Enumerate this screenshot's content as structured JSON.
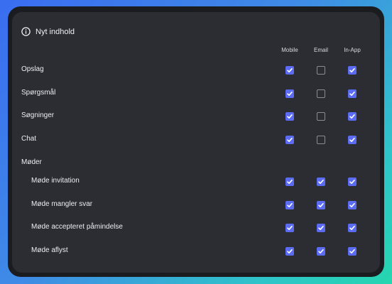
{
  "section": {
    "title": "Nyt indhold"
  },
  "columns": [
    "Mobile",
    "Email",
    "In-App"
  ],
  "rows": [
    {
      "label": "Opslag",
      "mobile": true,
      "email": false,
      "inapp": true
    },
    {
      "label": "Spørgsmål",
      "mobile": true,
      "email": false,
      "inapp": true
    },
    {
      "label": "Søgninger",
      "mobile": true,
      "email": false,
      "inapp": true
    },
    {
      "label": "Chat",
      "mobile": true,
      "email": false,
      "inapp": true
    }
  ],
  "group": {
    "label": "Møder",
    "rows": [
      {
        "label": "Møde invitation",
        "mobile": true,
        "email": true,
        "inapp": true
      },
      {
        "label": "Møde mangler svar",
        "mobile": true,
        "email": true,
        "inapp": true
      },
      {
        "label": "Møde accepteret påmindelse",
        "mobile": true,
        "email": true,
        "inapp": true
      },
      {
        "label": "Møde aflyst",
        "mobile": true,
        "email": true,
        "inapp": true
      }
    ]
  },
  "colors": {
    "checked": "#5b6cf2",
    "unchecked_border": "#8a8c92",
    "panel": "#2c2d32"
  },
  "icons": {
    "header": "info-icon",
    "checkbox_on": "checkmark-icon"
  }
}
